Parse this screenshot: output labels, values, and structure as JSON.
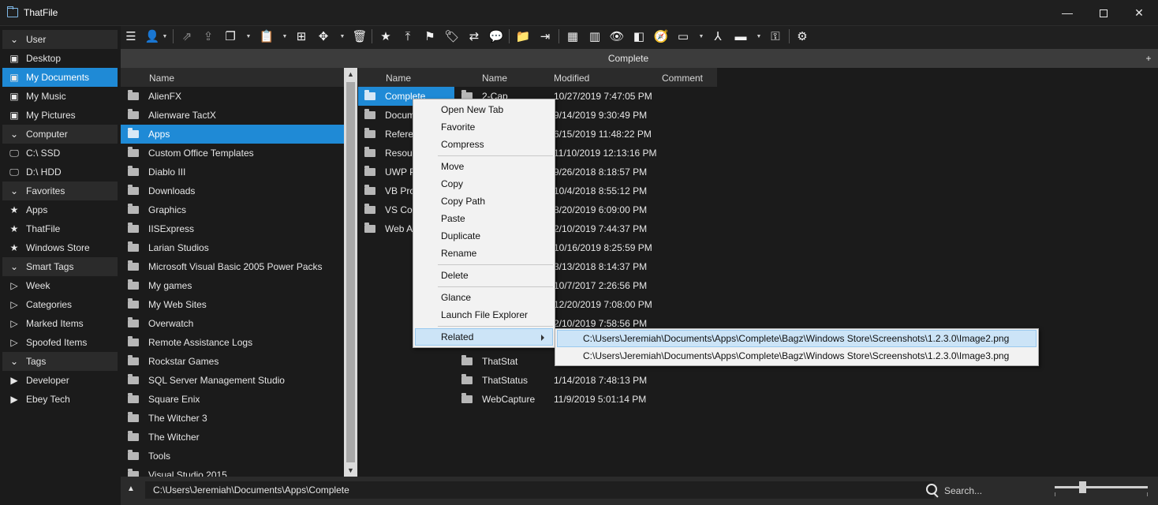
{
  "window": {
    "title": "ThatFile"
  },
  "sidebar": {
    "items": [
      {
        "label": "User",
        "kind": "group",
        "icon": "chevron-down-icon"
      },
      {
        "label": "Desktop",
        "kind": "item",
        "icon": "user-folder-icon"
      },
      {
        "label": "My Documents",
        "kind": "item",
        "icon": "user-folder-icon",
        "selected": true
      },
      {
        "label": "My Music",
        "kind": "item",
        "icon": "user-folder-icon"
      },
      {
        "label": "My Pictures",
        "kind": "item",
        "icon": "user-folder-icon"
      },
      {
        "label": "Computer",
        "kind": "group",
        "icon": "chevron-down-icon"
      },
      {
        "label": "C:\\ SSD",
        "kind": "item",
        "icon": "monitor-icon"
      },
      {
        "label": "D:\\ HDD",
        "kind": "item",
        "icon": "monitor-icon"
      },
      {
        "label": "Favorites",
        "kind": "group",
        "icon": "chevron-down-icon"
      },
      {
        "label": "Apps",
        "kind": "item",
        "icon": "star-icon"
      },
      {
        "label": "ThatFile",
        "kind": "item",
        "icon": "star-icon"
      },
      {
        "label": "Windows Store",
        "kind": "item",
        "icon": "star-icon"
      },
      {
        "label": "Smart Tags",
        "kind": "group",
        "icon": "chevron-down-icon"
      },
      {
        "label": "Week",
        "kind": "item",
        "icon": "tag-outline-icon"
      },
      {
        "label": "Categories",
        "kind": "item",
        "icon": "tag-outline-icon"
      },
      {
        "label": "Marked Items",
        "kind": "item",
        "icon": "tag-outline-icon"
      },
      {
        "label": "Spoofed Items",
        "kind": "item",
        "icon": "tag-outline-icon"
      },
      {
        "label": "Tags",
        "kind": "group",
        "icon": "chevron-down-icon"
      },
      {
        "label": "Developer",
        "kind": "item",
        "icon": "tag-icon"
      },
      {
        "label": "Ebey Tech",
        "kind": "item",
        "icon": "tag-icon"
      }
    ]
  },
  "tab": {
    "title": "Complete",
    "add_label": "+"
  },
  "pane1": {
    "header": {
      "name": "Name"
    },
    "rows": [
      "AlienFX",
      "Alienware TactX",
      "Apps",
      "Custom Office Templates",
      "Diablo III",
      "Downloads",
      "Graphics",
      "IISExpress",
      "Larian Studios",
      "Microsoft Visual Basic 2005 Power Packs",
      "My games",
      "My Web Sites",
      "Overwatch",
      "Remote Assistance Logs",
      "Rockstar Games",
      "SQL Server Management Studio",
      "Square Enix",
      "The Witcher 3",
      "The Witcher",
      "Tools",
      "Visual Studio 2015"
    ],
    "selected_index": 2
  },
  "pane2": {
    "header": {
      "name": "Name"
    },
    "rows": [
      "Complete",
      "Docum",
      "Refere",
      "Resour",
      "UWP P",
      "VB Proj",
      "VS Coo",
      "Web A"
    ],
    "selected_index": 0
  },
  "pane3": {
    "header": {
      "name": "Name",
      "modified": "Modified",
      "comment": "Comment"
    },
    "rows": [
      {
        "name": "2-Cap",
        "modified": "10/27/2019 7:47:05 PM"
      },
      {
        "name": "",
        "modified": "9/14/2019 9:30:49 PM"
      },
      {
        "name": "",
        "modified": "6/15/2019 11:48:22 PM"
      },
      {
        "name": "",
        "modified": "11/10/2019 12:13:16 PM"
      },
      {
        "name": "",
        "modified": "9/26/2018 8:18:57 PM"
      },
      {
        "name": "",
        "modified": "10/4/2018 8:55:12 PM"
      },
      {
        "name": "",
        "modified": "8/20/2019 6:09:00 PM"
      },
      {
        "name": "",
        "modified": "2/10/2019 7:44:37 PM"
      },
      {
        "name": "",
        "modified": "10/16/2019 8:25:59 PM"
      },
      {
        "name": "",
        "modified": "3/13/2018 8:14:37 PM"
      },
      {
        "name": "",
        "modified": "10/7/2017 2:26:56 PM"
      },
      {
        "name": "",
        "modified": "12/20/2019 7:08:00 PM"
      },
      {
        "name": "",
        "modified": "2/10/2019 7:58:56 PM"
      },
      {
        "name": "",
        "modified": ""
      },
      {
        "name": "ThatStat",
        "modified": ""
      },
      {
        "name": "ThatStatus",
        "modified": "1/14/2018 7:48:13 PM"
      },
      {
        "name": "WebCapture",
        "modified": "11/9/2019 5:01:14 PM"
      }
    ]
  },
  "context_menu": {
    "items": [
      "Open New Tab",
      "Favorite",
      "Compress",
      "Move",
      "Copy",
      "Copy Path",
      "Paste",
      "Duplicate",
      "Rename",
      "Delete",
      "Glance",
      "Launch File Explorer",
      "Related"
    ],
    "highlighted": "Related"
  },
  "submenu": {
    "items": [
      "C:\\Users\\Jeremiah\\Documents\\Apps\\Complete\\Bagz\\Windows Store\\Screenshots\\1.2.3.0\\Image2.png",
      "C:\\Users\\Jeremiah\\Documents\\Apps\\Complete\\Bagz\\Windows Store\\Screenshots\\1.2.3.0\\Image3.png"
    ]
  },
  "bottombar": {
    "path": "C:\\Users\\Jeremiah\\Documents\\Apps\\Complete",
    "search_placeholder": "Search...",
    "zoom_level": 0.3
  },
  "colors": {
    "accent": "#1f8ad6",
    "background": "#1b1b1b",
    "menu_bg": "#f2f2f2",
    "menu_highlight": "#cce4f7"
  }
}
